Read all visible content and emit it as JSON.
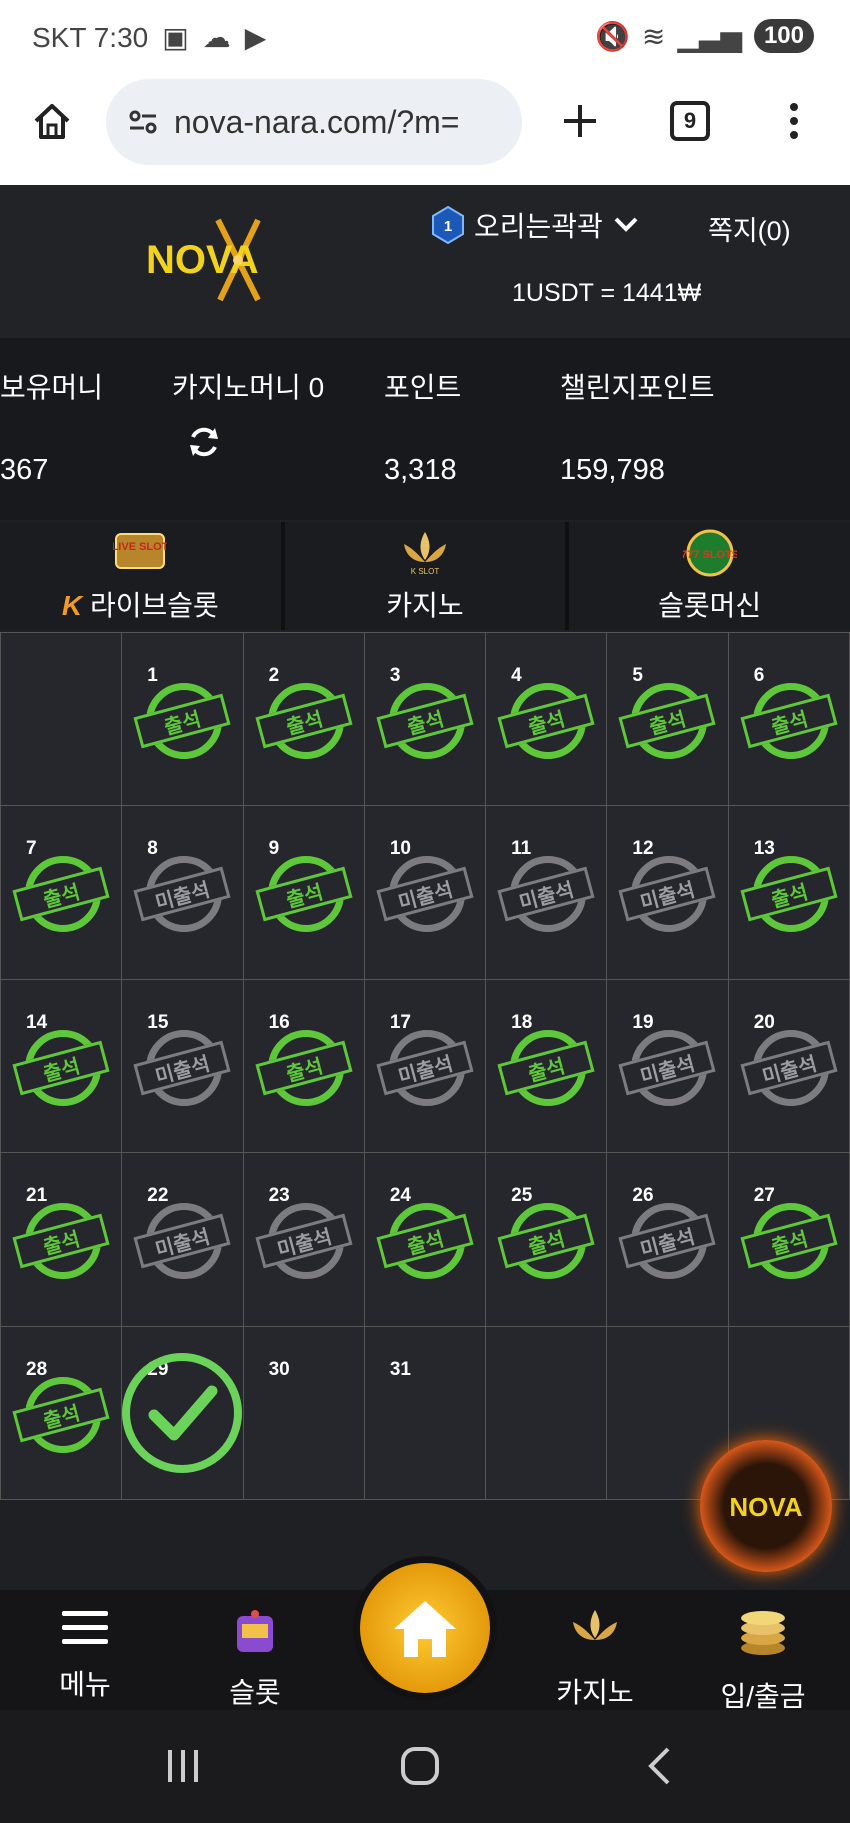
{
  "statusbar": {
    "carrier_time": "SKT 7:30",
    "battery": "100"
  },
  "browser": {
    "url": "nova-nara.com/?m=",
    "tab_count": "9"
  },
  "header": {
    "logo_text": "NOVA",
    "username": "오리는곽곽",
    "level": "1",
    "memo_label": "쪽지(0)",
    "exchange_rate": "1USDT = 1441₩"
  },
  "balances": {
    "holding_label": "보유머니",
    "holding_value": "367",
    "casino_money_label": "카지노머니 0",
    "point_label": "포인트",
    "point_value": "3,318",
    "challenge_label": "챌린지포인트",
    "challenge_value": "159,798"
  },
  "game_tabs": [
    {
      "label": "라이브슬롯",
      "icon_text": "LIVE SLOT"
    },
    {
      "label": "카지노",
      "icon_text": "K SLOT"
    },
    {
      "label": "슬롯머신",
      "icon_text": "777 SLOTS"
    }
  ],
  "attendance": {
    "present_text": "출석",
    "absent_text": "미출석",
    "colors": {
      "present": "#5ec73a",
      "absent": "#7b7b80"
    },
    "days": [
      {
        "day": "1",
        "status": "present"
      },
      {
        "day": "2",
        "status": "present"
      },
      {
        "day": "3",
        "status": "present"
      },
      {
        "day": "4",
        "status": "present"
      },
      {
        "day": "5",
        "status": "present"
      },
      {
        "day": "6",
        "status": "present"
      },
      {
        "day": "7",
        "status": "present"
      },
      {
        "day": "8",
        "status": "absent"
      },
      {
        "day": "9",
        "status": "present"
      },
      {
        "day": "10",
        "status": "absent"
      },
      {
        "day": "11",
        "status": "absent"
      },
      {
        "day": "12",
        "status": "absent"
      },
      {
        "day": "13",
        "status": "present"
      },
      {
        "day": "14",
        "status": "present"
      },
      {
        "day": "15",
        "status": "absent"
      },
      {
        "day": "16",
        "status": "present"
      },
      {
        "day": "17",
        "status": "absent"
      },
      {
        "day": "18",
        "status": "present"
      },
      {
        "day": "19",
        "status": "absent"
      },
      {
        "day": "20",
        "status": "absent"
      },
      {
        "day": "21",
        "status": "present"
      },
      {
        "day": "22",
        "status": "absent"
      },
      {
        "day": "23",
        "status": "absent"
      },
      {
        "day": "24",
        "status": "present"
      },
      {
        "day": "25",
        "status": "present"
      },
      {
        "day": "26",
        "status": "absent"
      },
      {
        "day": "27",
        "status": "present"
      },
      {
        "day": "28",
        "status": "present"
      },
      {
        "day": "29",
        "status": "today"
      },
      {
        "day": "30",
        "status": "none"
      },
      {
        "day": "31",
        "status": "none"
      }
    ]
  },
  "bottom_nav": {
    "menu": "메뉴",
    "slot": "슬롯",
    "casino": "카지노",
    "deposit": "입/출금"
  }
}
